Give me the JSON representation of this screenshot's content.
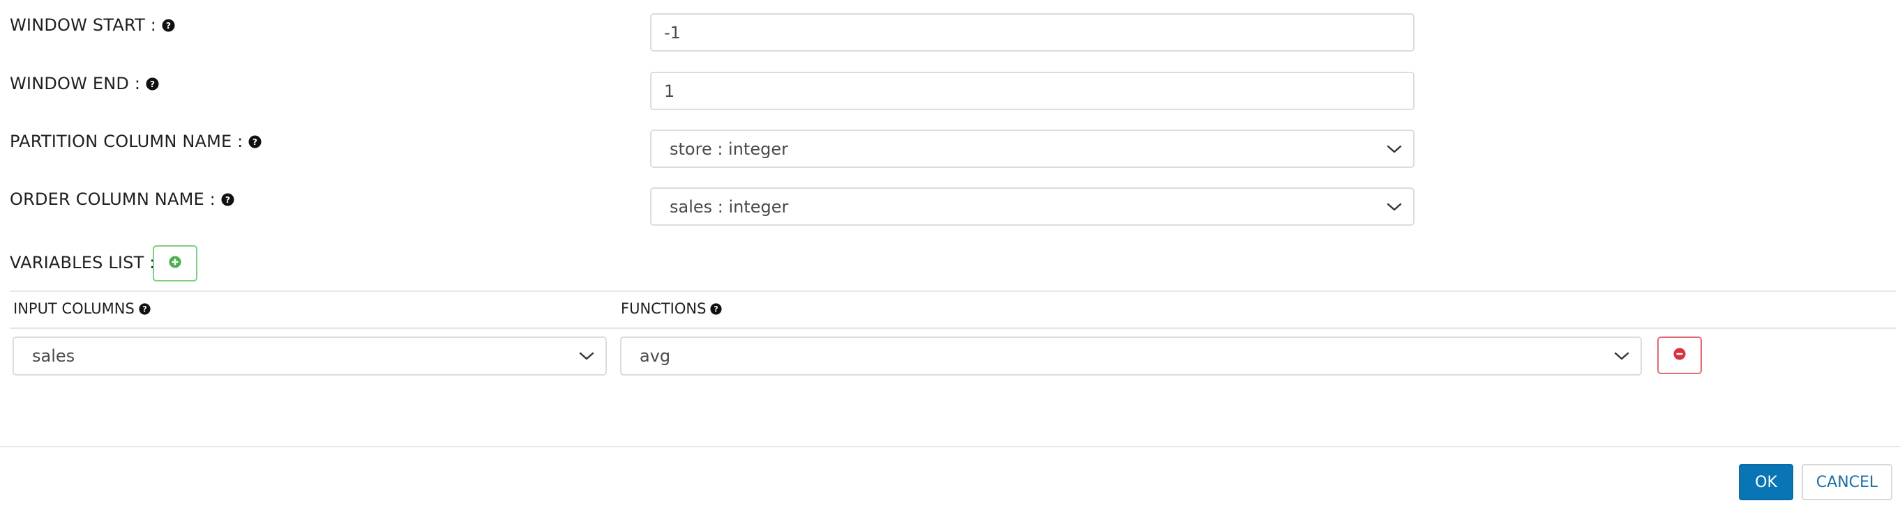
{
  "form": {
    "window_start": {
      "label": "WINDOW START :",
      "value": "-1"
    },
    "window_end": {
      "label": "WINDOW END :",
      "value": "1"
    },
    "partition_column": {
      "label": "PARTITION COLUMN NAME :",
      "value": "store : integer"
    },
    "order_column": {
      "label": "ORDER COLUMN NAME :",
      "value": "sales : integer"
    }
  },
  "variables": {
    "label": "VARIABLES LIST :",
    "columns": {
      "input": "INPUT COLUMNS",
      "functions": "FUNCTIONS"
    },
    "rows": [
      {
        "input_column": "sales",
        "function": "avg"
      }
    ]
  },
  "footer": {
    "ok_label": "OK",
    "cancel_label": "CANCEL"
  },
  "icons": {
    "help": "question-circle-icon",
    "add": "plus-circle-icon",
    "remove": "minus-circle-icon",
    "dropdown": "chevron-down-icon"
  },
  "colors": {
    "primary": "#0a75b5",
    "add_green": "#4caf50",
    "remove_red": "#d9333f",
    "border": "#dcdcdc"
  }
}
